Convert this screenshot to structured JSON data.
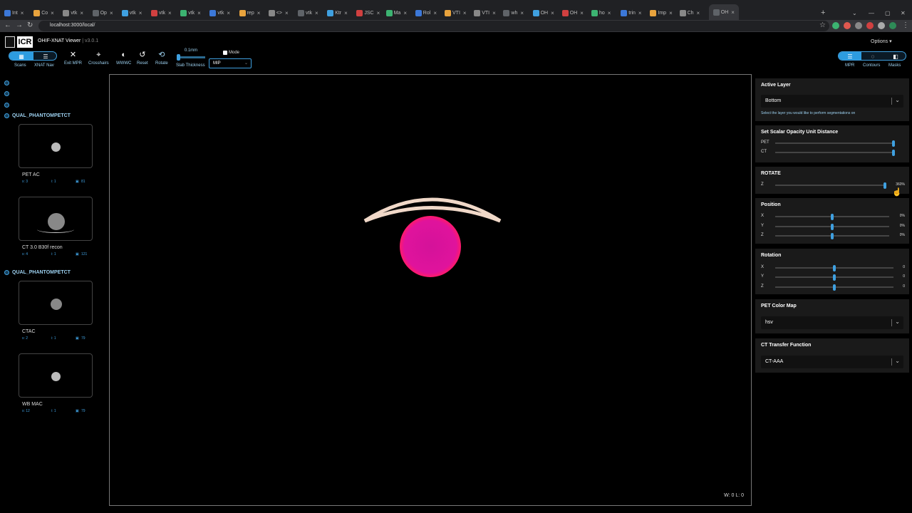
{
  "browser": {
    "tabs": [
      "Int",
      "Co",
      "vtk",
      "Op",
      "vtk",
      "vtk",
      "vtk",
      "vtk",
      "rep",
      "<> ",
      "vtk",
      "Ktr",
      "JSC",
      "Ma",
      "Rol",
      "VTI",
      "VTI",
      "wh",
      "OH",
      "OH",
      "ho",
      "trin",
      "Imp",
      "Ch",
      "OH"
    ],
    "url": "localhost:3000/local/",
    "new_tab": "+"
  },
  "app": {
    "logo_text": "ICR",
    "title": "OHIF-XNAT Viewer",
    "version": "| v3.0.1",
    "options_label": "Options"
  },
  "toolbar": {
    "scans_label": "Scans",
    "xnat_nav_label": "XNAT Nav",
    "exit_mpr_label": "Exit MPR",
    "crosshairs_label": "Crosshairs",
    "wwwc_label": "WWWC",
    "reset_label": "Reset",
    "rotate_label": "Rotate",
    "slab_value": "0.1mm",
    "slab_label": "Slab Thickness",
    "mode_label": "Mode",
    "mode_select_value": "MIP"
  },
  "right_toggle": {
    "mpr_label": "MPR",
    "contours_label": "Contours",
    "masks_label": "Masks"
  },
  "studies": [
    {
      "name": "QUAL_PHANTOMPETCT",
      "series": [
        {
          "label": "PET AC",
          "s": "s: 3",
          "i": "i: 1",
          "count": "81"
        },
        {
          "label": "CT 3.0 B30f recon",
          "s": "s: 4",
          "i": "i: 1",
          "count": "121"
        }
      ]
    },
    {
      "name": "QUAL_PHANTOMPETCT",
      "series": [
        {
          "label": "CTAC",
          "s": "s: 2",
          "i": "i: 1",
          "count": "79"
        },
        {
          "label": "WB MAC",
          "s": "s: 12",
          "i": "i: 1",
          "count": "79"
        }
      ]
    }
  ],
  "viewport": {
    "wl_text": "W: 0 L: 0"
  },
  "panel": {
    "active_layer": {
      "title": "Active Layer",
      "value": "Bottom",
      "hint": "Select the layer you would like to perform segmentations on"
    },
    "opacity": {
      "title": "Set Scalar Opacity Unit Distance",
      "pet_label": "PET",
      "ct_label": "CT",
      "pet_level": 1.0,
      "ct_level": 1.0
    },
    "rotate": {
      "title": "ROTATE",
      "z_label": "Z",
      "z_value": "360%",
      "z_level": 1.0
    },
    "position": {
      "title": "Position",
      "x_label": "X",
      "x_value": "0%",
      "y_label": "Y",
      "y_value": "0%",
      "z_label": "Z",
      "z_value": "0%"
    },
    "rotation": {
      "title": "Rotation",
      "x_label": "X",
      "x_value": "0",
      "y_label": "Y",
      "y_value": "0",
      "z_label": "Z",
      "z_value": "0"
    },
    "pet_colormap": {
      "title": "PET Color Map",
      "value": "hsv"
    },
    "ct_transfer": {
      "title": "CT Transfer Function",
      "value": "CT-AAA"
    }
  },
  "colors": {
    "accent": "#3fa0e0",
    "sphere": "#e0139c",
    "arc": "#f0d8c8"
  }
}
